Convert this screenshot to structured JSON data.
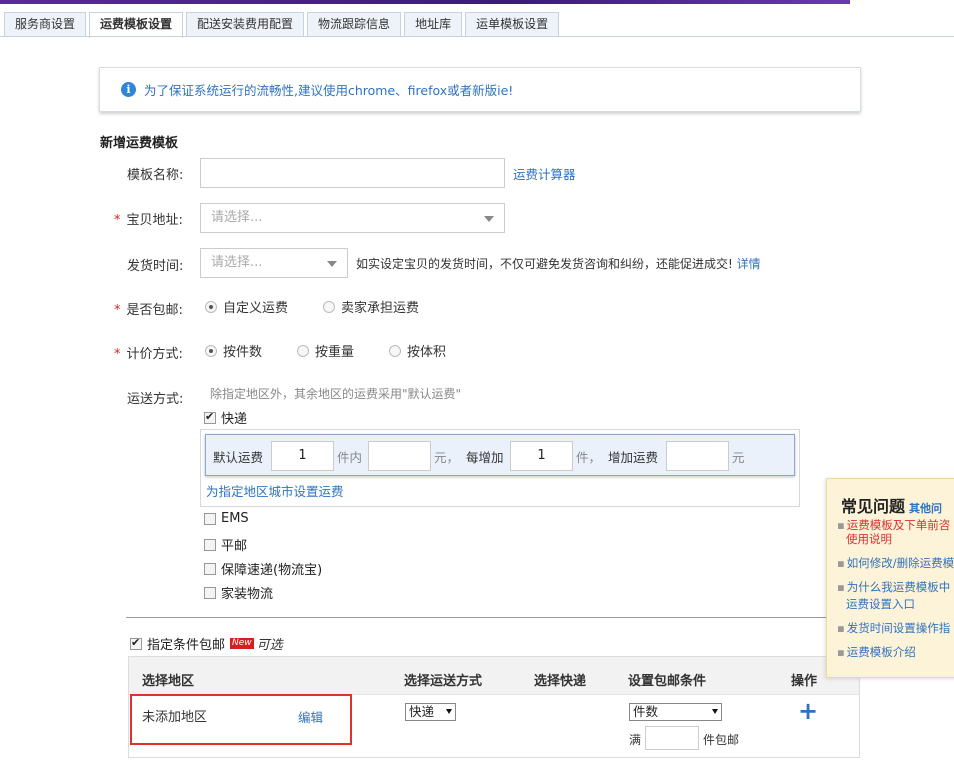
{
  "tabs": [
    "服务商设置",
    "运费模板设置",
    "配送安装费用配置",
    "物流跟踪信息",
    "地址库",
    "运单模板设置"
  ],
  "notice": {
    "icon": "info-icon",
    "text": "为了保证系统运行的流畅性,建议使用chrome、firefox或者新版ie!"
  },
  "form": {
    "section_title": "新增运费模板",
    "template_name_label": "模板名称:",
    "template_name_value": "",
    "calculator_link": "运费计算器",
    "address_label": "宝贝地址:",
    "address_placeholder": "请选择...",
    "ship_time_label": "发货时间:",
    "ship_time_placeholder": "请选择...",
    "ship_time_hint": "如实设定宝贝的发货时间，不仅可避免发货咨询和纠纷，还能促进成交!",
    "ship_time_detail": "详情",
    "free_label": "是否包邮:",
    "free_options": [
      "自定义运费",
      "卖家承担运费"
    ],
    "pricing_label": "计价方式:",
    "pricing_options": [
      "按件数",
      "按重量",
      "按体积"
    ],
    "delivery_label": "运送方式:",
    "delivery_hint": "除指定地区外，其余地区的运费采用\"默认运费\"",
    "express_label": "快递",
    "rate": {
      "default_fee_label": "默认运费",
      "first_qty": "1",
      "first_unit": "件内",
      "first_fee": "",
      "yuan1": "元，",
      "each_add_label": "每增加",
      "add_qty": "1",
      "add_unit": "件，",
      "add_fee_label": "增加运费",
      "add_fee": "",
      "yuan2": "元"
    },
    "city_link": "为指定地区城市设置运费",
    "other_methods": [
      "EMS",
      "平邮",
      "保障速递(物流宝)",
      "家装物流"
    ],
    "conditional_free_label": "指定条件包邮",
    "new_badge": "New",
    "optional_label": "可选"
  },
  "table": {
    "headers": [
      "选择地区",
      "选择运送方式",
      "选择快递",
      "设置包邮条件",
      "操作"
    ],
    "row": {
      "region": "未添加地区",
      "edit": "编辑",
      "method": "快递",
      "condition": "件数",
      "full_prefix": "满",
      "full_value": "",
      "full_suffix": "件包邮"
    }
  },
  "faq": {
    "title": "常见问题",
    "more": "其他问",
    "items": [
      "运费模板及下单前咨",
      "使用说明",
      "如何修改/删除运费模",
      "为什么我运费模板中",
      "运费设置入口",
      "发货时间设置操作指",
      "运费模板介绍"
    ]
  }
}
